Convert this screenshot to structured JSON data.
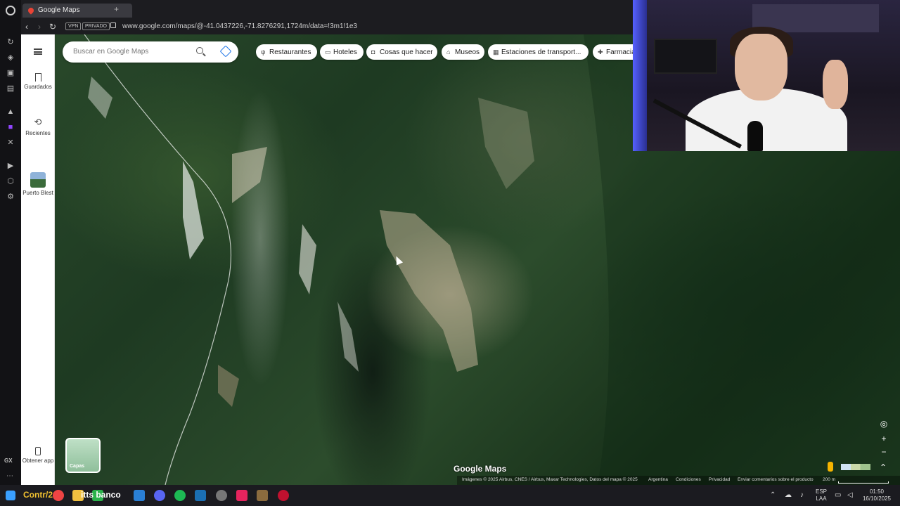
{
  "browser": {
    "tab_title": "Google Maps",
    "new_tab": "+",
    "vpn_badge": "VPN",
    "private_badge": "PRIVADO",
    "url": "www.google.com/maps/@-41.0437226,-71.8276291,1724m/data=!3m1!1e3",
    "sidebar_gx": "GX"
  },
  "maps": {
    "search_placeholder": "Buscar en Google Maps",
    "rail": {
      "saved_label": "Guardados",
      "recent_label": "Recientes",
      "place_label": "Puerto Blest",
      "get_app_label": "Obtener app"
    },
    "chips": [
      {
        "label": "Restaurantes",
        "icon": "fork-knife-icon"
      },
      {
        "label": "Hoteles",
        "icon": "bed-icon"
      },
      {
        "label": "Cosas que hacer",
        "icon": "camera-icon"
      },
      {
        "label": "Museos",
        "icon": "museum-icon"
      },
      {
        "label": "Estaciones de transport...",
        "icon": "train-icon"
      },
      {
        "label": "Farmacias",
        "icon": "pharmacy-icon"
      }
    ],
    "layers_label": "Capas",
    "watermark": "Google Maps",
    "attribution": "Imágenes © 2025 Airbus, CNES / Airbus, Maxar Technologies, Datos del mapa © 2025",
    "footer_links": [
      "Argentina",
      "Condiciones",
      "Privacidad",
      "Enviar comentarios sobre el producto"
    ],
    "scale": "200 m"
  },
  "taskbar": {
    "label_counter": "Contr/260",
    "label_app": "itts banco",
    "lang_top": "ESP",
    "lang_bottom": "LAA",
    "time": "01:50",
    "date": "16/10/2025"
  }
}
